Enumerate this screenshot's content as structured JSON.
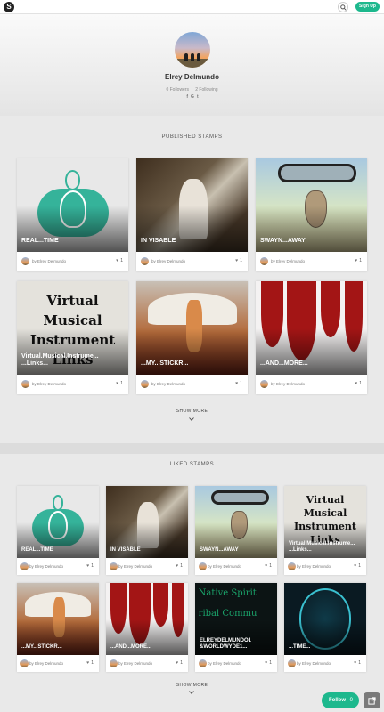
{
  "topbar": {
    "logo_letter": "S",
    "signup_label": "Sign Up"
  },
  "profile": {
    "name": "Elrey Delmundo",
    "followers_count": "0",
    "followers_label": "Followers",
    "following_count": "2",
    "following_label": "Following",
    "social": [
      "f",
      "G",
      "t"
    ]
  },
  "published": {
    "heading": "PUBLISHED STAMPS",
    "show_more": "SHOW MORE",
    "cards": [
      {
        "title": "REAL...TIME",
        "author": "by Elrey Delmundo",
        "likes": "1",
        "art": "head"
      },
      {
        "title": "IN VISABLE",
        "author": "by Elrey Delmundo",
        "likes": "1",
        "art": "photo"
      },
      {
        "title": "SWAYN...AWAY",
        "author": "by Elrey Delmundo",
        "likes": "1",
        "art": "mirror"
      },
      {
        "title": "Virtual.Musical.Instrume... ...Links...",
        "author": "by Elrey Delmundo",
        "likes": "1",
        "art": "music"
      },
      {
        "title": "...MY...STICKR...",
        "author": "by Elrey Delmundo",
        "likes": "1",
        "art": "zep"
      },
      {
        "title": "...AND...MORE...",
        "author": "by Elrey Delmundo",
        "likes": "1",
        "art": "ink"
      }
    ]
  },
  "liked": {
    "heading": "LIKED STAMPS",
    "show_more": "SHOW MORE",
    "cards": [
      {
        "title": "REAL...TIME",
        "author": "by Elrey Delmundo",
        "likes": "1",
        "art": "head"
      },
      {
        "title": "IN VISABLE",
        "author": "by Elrey Delmundo",
        "likes": "1",
        "art": "photo"
      },
      {
        "title": "SWAYN...AWAY",
        "author": "by Elrey Delmundo",
        "likes": "1",
        "art": "mirror"
      },
      {
        "title": "Virtual.Musical.Instrume... ...Links...",
        "author": "by Elrey Delmundo",
        "likes": "1",
        "art": "music"
      },
      {
        "title": "...MY...STICKR...",
        "author": "by Elrey Delmundo",
        "likes": "1",
        "art": "zep"
      },
      {
        "title": "...AND...MORE...",
        "author": "by Elrey Delmundo",
        "likes": "1",
        "art": "ink"
      },
      {
        "title": "ELREYDELMUNDO1 &WORLDWYDE1...",
        "author": "by Elrey Delmundo",
        "likes": "1",
        "art": "spirit"
      },
      {
        "title": "...TIME...",
        "author": "by Elrey Delmundo",
        "likes": "1",
        "art": "clock"
      }
    ]
  },
  "art_text": {
    "music_lines": [
      "Virtual",
      "Musical",
      "Instrument",
      "Links"
    ],
    "spirit_lines": [
      "Native Spirit",
      "ribal Commu"
    ]
  },
  "footer": {
    "follow_label": "Follow",
    "follow_count": "0"
  },
  "colors": {
    "accent": "#1db88d",
    "background": "#e9e9e9"
  }
}
